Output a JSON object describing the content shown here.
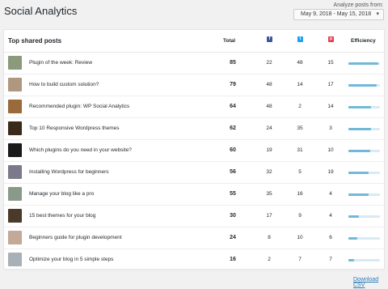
{
  "page": {
    "title": "Social Analytics"
  },
  "date_range": {
    "label": "Analyze posts from:",
    "value": "May 9, 2018 - May 15, 2018"
  },
  "table": {
    "title": "Top shared posts",
    "col_total": "Total",
    "col_efficiency": "Efficiency",
    "icons": {
      "facebook": "facebook-icon",
      "twitter": "twitter-icon",
      "pinterest": "pinterest-icon"
    },
    "rows": [
      {
        "title": "Plugin of the week: Review",
        "total": "85",
        "facebook": "22",
        "twitter": "48",
        "pinterest": "15",
        "efficiency": 0.96,
        "thumb_color": "#8a9a7a"
      },
      {
        "title": "How to build custom solution?",
        "total": "79",
        "facebook": "48",
        "twitter": "14",
        "pinterest": "17",
        "efficiency": 0.9,
        "thumb_color": "#b09880"
      },
      {
        "title": "Recommended plugin: WP Social Analytics",
        "total": "64",
        "facebook": "48",
        "twitter": "2",
        "pinterest": "14",
        "efficiency": 0.73,
        "thumb_color": "#9a6a3a"
      },
      {
        "title": "Top 10 Responsive Wordpress themes",
        "total": "62",
        "facebook": "24",
        "twitter": "35",
        "pinterest": "3",
        "efficiency": 0.71,
        "thumb_color": "#3a2a1a"
      },
      {
        "title": "Which plugins do you need in your website?",
        "total": "60",
        "facebook": "19",
        "twitter": "31",
        "pinterest": "10",
        "efficiency": 0.69,
        "thumb_color": "#1a1a1a"
      },
      {
        "title": "Installing Wordpress for beginners",
        "total": "56",
        "facebook": "32",
        "twitter": "5",
        "pinterest": "19",
        "efficiency": 0.64,
        "thumb_color": "#7a7a8a"
      },
      {
        "title": "Manage your blog like a pro",
        "total": "55",
        "facebook": "35",
        "twitter": "16",
        "pinterest": "4",
        "efficiency": 0.63,
        "thumb_color": "#8a9a8a"
      },
      {
        "title": "15 best themes for your blog",
        "total": "30",
        "facebook": "17",
        "twitter": "9",
        "pinterest": "4",
        "efficiency": 0.34,
        "thumb_color": "#4a3a2a"
      },
      {
        "title": "Beginners guide for plugin development",
        "total": "24",
        "facebook": "8",
        "twitter": "10",
        "pinterest": "6",
        "efficiency": 0.27,
        "thumb_color": "#c4a898"
      },
      {
        "title": "Optimize your blog in 5 simple steps",
        "total": "16",
        "facebook": "2",
        "twitter": "7",
        "pinterest": "7",
        "efficiency": 0.18,
        "thumb_color": "#a8b0b8"
      }
    ]
  },
  "footer": {
    "download_label": "Download CSV"
  },
  "colors": {
    "accent": "#72b8d8",
    "bar_bg": "#d8eaf3",
    "facebook": "#3b5998",
    "twitter": "#1da1f2",
    "pinterest": "#e0404f",
    "link": "#2b7bb9"
  }
}
